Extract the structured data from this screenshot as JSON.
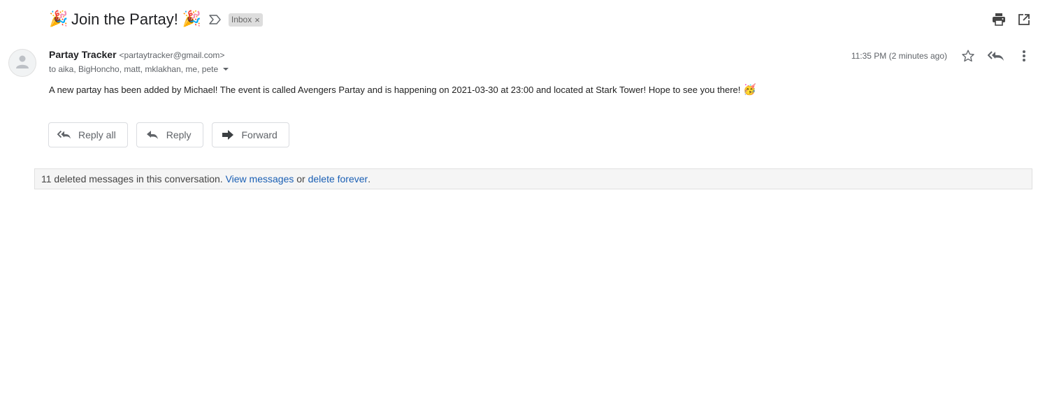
{
  "subject": {
    "emoji_left": "🎉",
    "title": "Join the Partay!",
    "emoji_right": "🎉",
    "importance_icon": "importance-marker-icon",
    "label": {
      "text": "Inbox",
      "close": "×"
    }
  },
  "toolbar": {
    "print_icon": "print-icon",
    "popout_icon": "open-in-new-window-icon"
  },
  "message": {
    "avatar_icon": "person-icon",
    "sender_name": "Partay Tracker",
    "sender_email": "<partaytracker@gmail.com>",
    "recipients": "to aika, BigHoncho, matt, mklakhan, me, pete",
    "timestamp": "11:35 PM (2 minutes ago)",
    "body": "A new partay has been added by Michael! The event is called Avengers Partay and is happening on 2021-03-30 at 23:00 and located at Stark Tower! Hope to see you there!",
    "body_emoji": "🥳"
  },
  "actions": {
    "reply_all": "Reply all",
    "reply": "Reply",
    "forward": "Forward"
  },
  "deleted_notice": {
    "text": "11 deleted messages in this conversation.",
    "view_link": "View messages",
    "or": "or",
    "delete_link": "delete forever",
    "end": "."
  },
  "colors": {
    "link": "#1a5fb4",
    "chip_background": "#dddddd",
    "notice_background": "#f5f5f5"
  }
}
